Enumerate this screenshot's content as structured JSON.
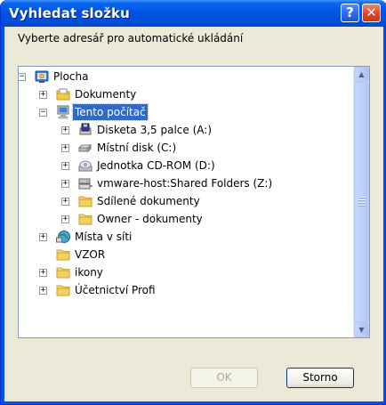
{
  "window": {
    "title": "Vyhledat složku",
    "help_glyph": "?",
    "close_glyph": "✕"
  },
  "prompt": "Vyberte adresář pro automatické ukládání",
  "tree": [
    {
      "label": "Plocha",
      "icon": "desktop-icon",
      "expander": "−",
      "level": 0
    },
    {
      "label": "Dokumenty",
      "icon": "folder-documents-icon",
      "expander": "+",
      "level": 1
    },
    {
      "label": "Tento počítač",
      "icon": "computer-icon",
      "expander": "−",
      "level": 1,
      "selected": true
    },
    {
      "label": "Disketa 3,5 palce (A:)",
      "icon": "floppy-drive-icon",
      "expander": "+",
      "level": 2
    },
    {
      "label": "Místní disk (C:)",
      "icon": "hard-disk-icon",
      "expander": "+",
      "level": 2
    },
    {
      "label": "Jednotka CD-ROM (D:)",
      "icon": "cd-drive-icon",
      "expander": "+",
      "level": 2
    },
    {
      "label": "vmware-host:Shared Folders (Z:)",
      "icon": "network-drive-icon",
      "expander": "+",
      "level": 2
    },
    {
      "label": "Sdílené dokumenty",
      "icon": "folder-icon",
      "expander": "+",
      "level": 2
    },
    {
      "label": "Owner - dokumenty",
      "icon": "folder-icon",
      "expander": "+",
      "level": 2
    },
    {
      "label": "Místa v síti",
      "icon": "network-places-icon",
      "expander": "+",
      "level": 1
    },
    {
      "label": "VZOR",
      "icon": "folder-icon",
      "expander": "",
      "level": 1
    },
    {
      "label": "ikony",
      "icon": "folder-icon",
      "expander": "+",
      "level": 1
    },
    {
      "label": "Účetnictví Profi",
      "icon": "folder-icon",
      "expander": "+",
      "level": 1
    }
  ],
  "buttons": {
    "ok": "OK",
    "cancel": "Storno"
  },
  "colors": {
    "title_blue": "#0054e3",
    "selection": "#316ac5",
    "dialog_bg": "#ece9d8",
    "close_red": "#e0451e"
  }
}
